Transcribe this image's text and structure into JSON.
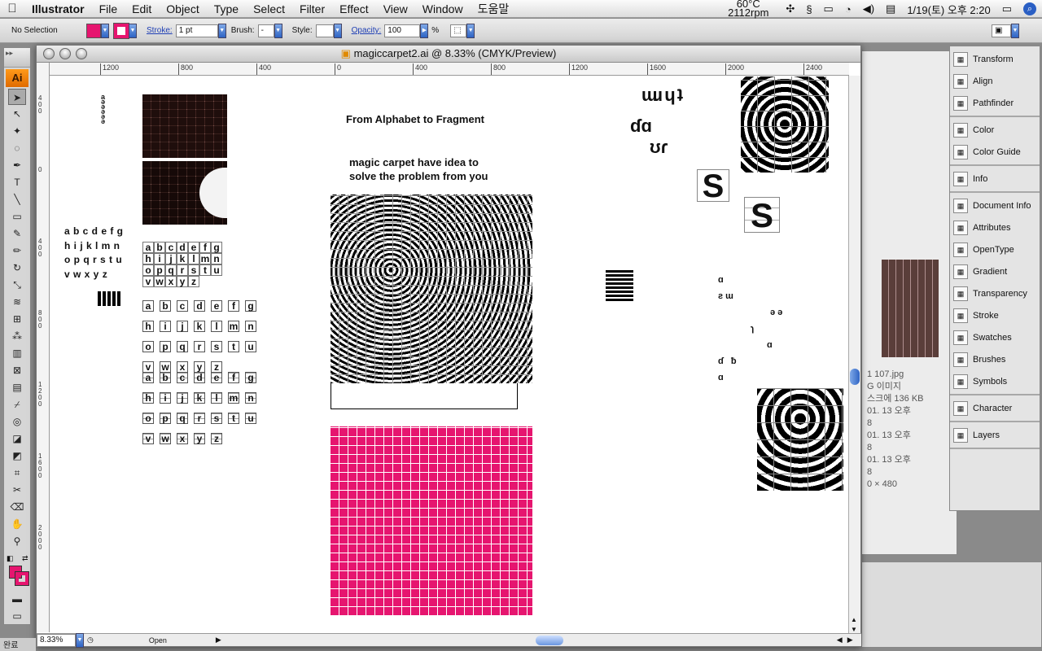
{
  "menubar": {
    "app_name": "Illustrator",
    "menus": [
      "File",
      "Edit",
      "Object",
      "Type",
      "Select",
      "Filter",
      "Effect",
      "View",
      "Window",
      "도움말"
    ],
    "status": {
      "temp": "60°C",
      "rpm": "2112rpm",
      "datetime": "1/19(토) 오후 2:20"
    }
  },
  "controlbar": {
    "selection": "No Selection",
    "stroke_label": "Stroke:",
    "stroke_value": "1 pt",
    "brush_label": "Brush:",
    "brush_value": "-",
    "style_label": "Style:",
    "opacity_label": "Opacity:",
    "opacity_value": "100",
    "opacity_unit": "%",
    "fill_color": "#e6156f"
  },
  "document": {
    "title": "magiccarpet2.ai @ 8.33% (CMYK/Preview)",
    "zoom": "8.33%",
    "status": "Open",
    "h_ruler_labels": [
      "1200",
      "800",
      "400",
      "0",
      "400",
      "800",
      "1200",
      "1600",
      "2000",
      "2400"
    ],
    "v_ruler_labels": [
      "4 0 0",
      "0",
      "4 0 0",
      "8 0 0",
      "1 2 0 0",
      "1 6 0 0",
      "2 0 0 0"
    ]
  },
  "artboard": {
    "heading": "From Alphabet to Fragment",
    "subheading_line1": "magic carpet have idea to",
    "subheading_line2": "solve the problem from you",
    "alphabet_lines": [
      "a b c d e f g",
      "h i j k l m n",
      "o p q r s t u",
      "v w x y z"
    ],
    "grid_letters": [
      [
        "a",
        "b",
        "c",
        "d",
        "e",
        "f",
        "g"
      ],
      [
        "h",
        "i",
        "j",
        "k",
        "l",
        "m",
        "n"
      ],
      [
        "o",
        "p",
        "q",
        "r",
        "s",
        "t",
        "u"
      ],
      [
        "v",
        "w",
        "x",
        "y",
        "z"
      ]
    ],
    "big_letter": "S",
    "accent_color": "#e6156f"
  },
  "panels": {
    "groups": [
      [
        {
          "label": "Transform",
          "icon": "transform-icon"
        },
        {
          "label": "Align",
          "icon": "align-icon"
        },
        {
          "label": "Pathfinder",
          "icon": "pathfinder-icon"
        }
      ],
      [
        {
          "label": "Color",
          "icon": "color-icon"
        },
        {
          "label": "Color Guide",
          "icon": "color-guide-icon"
        }
      ],
      [
        {
          "label": "Info",
          "icon": "info-icon"
        }
      ],
      [
        {
          "label": "Document Info",
          "icon": "document-info-icon"
        },
        {
          "label": "Attributes",
          "icon": "attributes-icon"
        },
        {
          "label": "OpenType",
          "icon": "opentype-icon"
        },
        {
          "label": "Gradient",
          "icon": "gradient-icon"
        },
        {
          "label": "Transparency",
          "icon": "transparency-icon"
        },
        {
          "label": "Stroke",
          "icon": "stroke-icon"
        },
        {
          "label": "Swatches",
          "icon": "swatches-icon"
        },
        {
          "label": "Brushes",
          "icon": "brushes-icon"
        },
        {
          "label": "Symbols",
          "icon": "symbols-icon"
        }
      ],
      [
        {
          "label": "Character",
          "icon": "character-icon"
        }
      ],
      [
        {
          "label": "Layers",
          "icon": "layers-icon"
        }
      ]
    ]
  },
  "background_window": {
    "lines": [
      "1 107.jpg",
      "G 이미지",
      "스크에 136 KB",
      "01. 13 오후",
      "8",
      "01. 13 오후",
      "8",
      "01. 13 오후",
      "8",
      "0 × 480"
    ]
  },
  "dock": {
    "label": "완료"
  }
}
